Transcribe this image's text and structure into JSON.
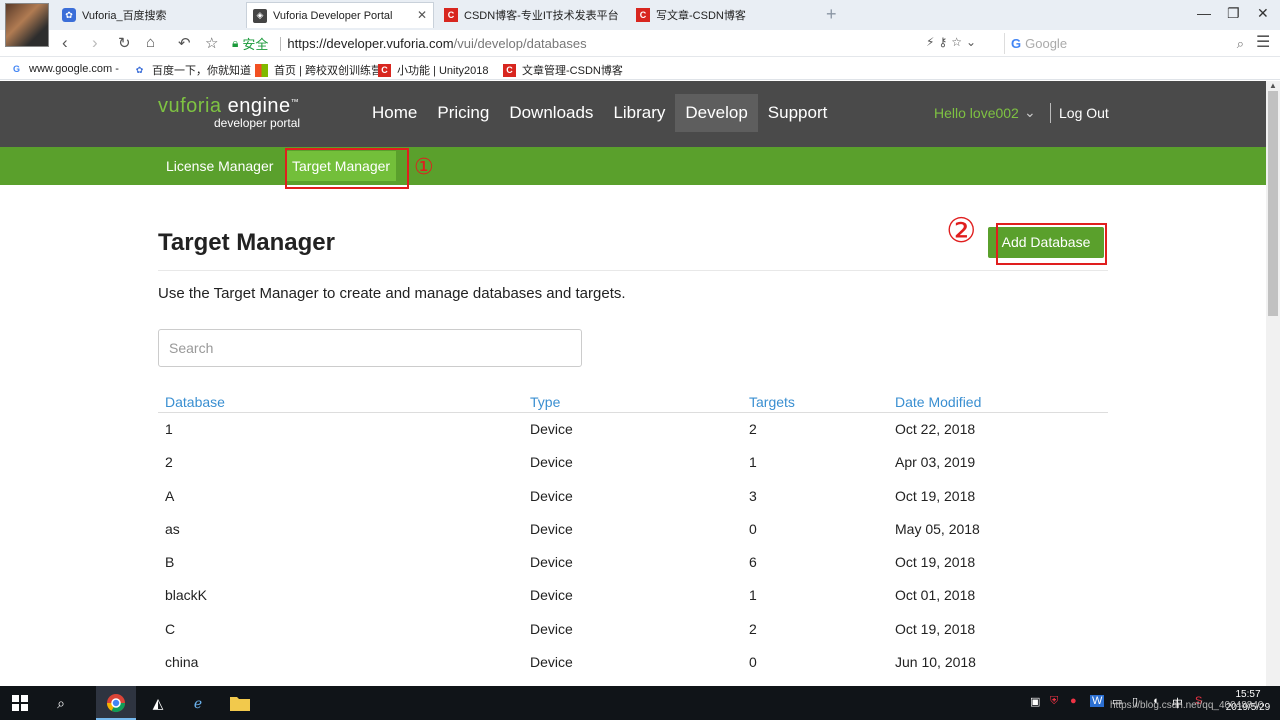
{
  "browser": {
    "tabs": [
      {
        "title": "Vuforia_百度搜索",
        "icon": "baidu-paw-icon",
        "active": false
      },
      {
        "title": "Vuforia Developer Portal",
        "icon": "vuforia-icon",
        "active": true
      },
      {
        "title": "CSDN博客-专业IT技术发表平台",
        "icon": "csdn-icon",
        "active": false
      },
      {
        "title": "写文章-CSDN博客",
        "icon": "csdn-icon",
        "active": false
      }
    ],
    "address": {
      "secure_label": "安全",
      "host": "https://developer.vuforia.com",
      "path": "/vui/develop/databases"
    },
    "search_placeholder": "Google",
    "bookmarks": [
      {
        "label": "www.google.com -",
        "icon": "google-icon"
      },
      {
        "label": "百度一下，你就知道",
        "icon": "baidu-paw-icon"
      },
      {
        "label": "首页 | 跨校双创训练营",
        "icon": "windows-flag-icon"
      },
      {
        "label": "小功能 | Unity2018",
        "icon": "csdn-icon"
      },
      {
        "label": "文章管理-CSDN博客",
        "icon": "csdn-icon"
      }
    ]
  },
  "header": {
    "logo_main": "vuforia",
    "logo_engine": "engine",
    "logo_tm": "™",
    "logo_sub": "developer portal",
    "nav": [
      "Home",
      "Pricing",
      "Downloads",
      "Library",
      "Develop",
      "Support"
    ],
    "active_nav": "Develop",
    "user_greeting": "Hello love002",
    "logout": "Log Out"
  },
  "subnav": {
    "items": [
      "License Manager",
      "Target Manager"
    ],
    "active": "Target Manager"
  },
  "annotations": {
    "one": "①",
    "two": "②"
  },
  "main": {
    "title": "Target Manager",
    "add_button": "Add Database",
    "description": "Use the Target Manager to create and manage databases and targets.",
    "search_placeholder": "Search"
  },
  "table": {
    "columns": [
      "Database",
      "Type",
      "Targets",
      "Date Modified"
    ],
    "rows": [
      [
        "1",
        "Device",
        "2",
        "Oct 22, 2018"
      ],
      [
        "2",
        "Device",
        "1",
        "Apr 03, 2019"
      ],
      [
        "A",
        "Device",
        "3",
        "Oct 19, 2018"
      ],
      [
        "as",
        "Device",
        "0",
        "May 05, 2018"
      ],
      [
        "B",
        "Device",
        "6",
        "Oct 19, 2018"
      ],
      [
        "blackK",
        "Device",
        "1",
        "Oct 01, 2018"
      ],
      [
        "C",
        "Device",
        "2",
        "Oct 19, 2018"
      ],
      [
        "china",
        "Device",
        "0",
        "Jun 10, 2018"
      ]
    ]
  },
  "taskbar": {
    "time": "15:57",
    "date": "2019/5/29",
    "ime_label": "中",
    "watermark": "https://blog.csdn.net/qq_40048840"
  },
  "colors": {
    "header_bg": "#4a4a4a",
    "brand_green": "#5aa02c",
    "link_blue": "#3a8fd1",
    "annotation_red": "#e01e1e"
  }
}
